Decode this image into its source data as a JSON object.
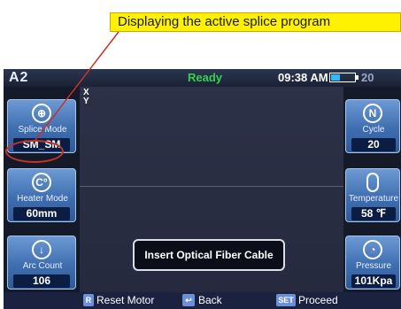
{
  "annotation": {
    "text": "Displaying the active splice program"
  },
  "status": {
    "logo": "A2",
    "state": "Ready",
    "time": "09:38 AM",
    "battery_text": "20",
    "battery_level_fraction": 0.4
  },
  "left_tiles": [
    {
      "icon": "crosshair-icon",
      "label": "Splice Mode",
      "value": "SM_SM"
    },
    {
      "icon": "heater-celsius-icon",
      "label": "Heater Mode",
      "value": "60mm"
    },
    {
      "icon": "arc-count-icon",
      "label": "Arc Count",
      "value": "106"
    }
  ],
  "right_tiles": [
    {
      "icon": "cycle-n-icon",
      "label": "Cycle",
      "value": "20"
    },
    {
      "icon": "thermometer-icon",
      "label": "Temperature",
      "value": "58 ℉"
    },
    {
      "icon": "gauge-icon",
      "label": "Pressure",
      "value": "101Kpa"
    }
  ],
  "view": {
    "axis_x": "X",
    "axis_y": "Y",
    "message": "Insert Optical Fiber Cable"
  },
  "bottom": {
    "reset_key": "R",
    "reset_label": "Reset Motor",
    "back_key": "↩",
    "back_label": "Back",
    "set_key": "SET",
    "set_label": "Proceed"
  },
  "colors": {
    "ready": "#34d24b",
    "callout_bg": "#fff200",
    "highlight": "#c43328",
    "tile": "#4a7cc0"
  }
}
